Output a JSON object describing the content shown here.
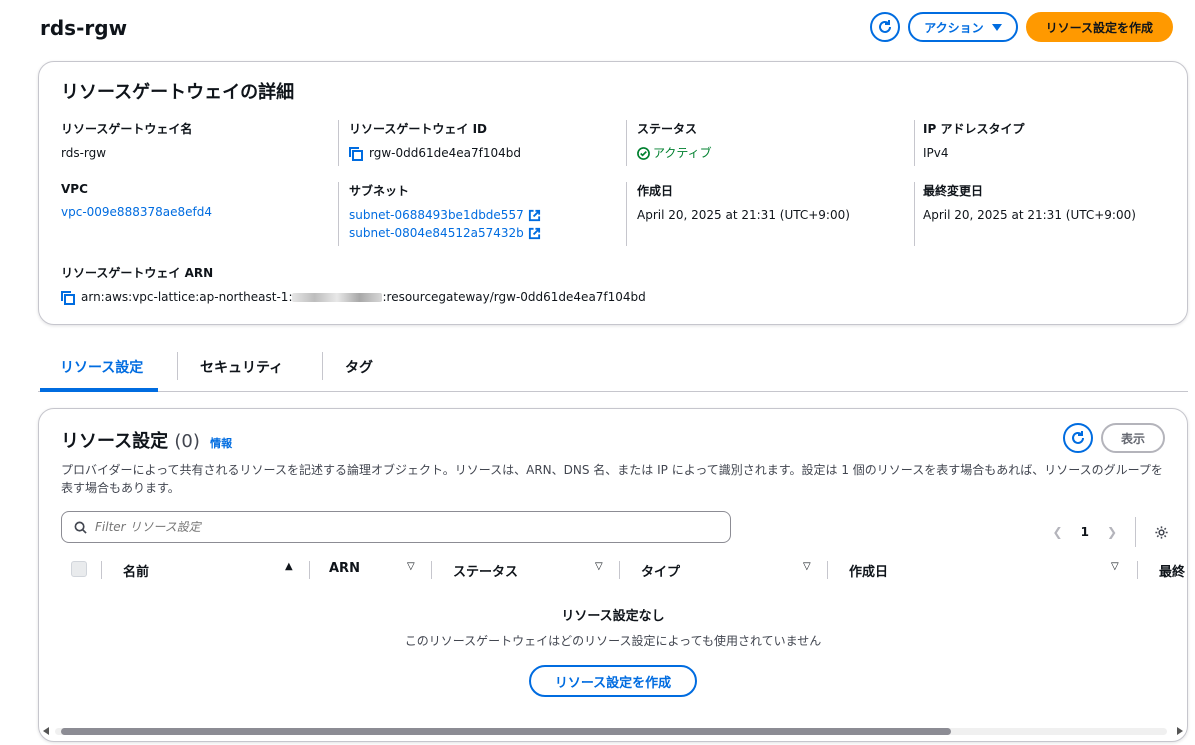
{
  "header": {
    "title": "rds-rgw",
    "refresh_icon": "refresh-icon",
    "actions_label": "アクション",
    "create_label": "リソース設定を作成"
  },
  "details": {
    "title": "リソースゲートウェイの詳細",
    "name_label": "リソースゲートウェイ名",
    "name_value": "rds-rgw",
    "id_label": "リソースゲートウェイ ID",
    "id_value": "rgw-0dd61de4ea7f104bd",
    "status_label": "ステータス",
    "status_value": "アクティブ",
    "ip_label": "IP アドレスタイプ",
    "ip_value": "IPv4",
    "vpc_label": "VPC",
    "vpc_value": "vpc-009e888378ae8efd4",
    "subnet_label": "サブネット",
    "subnets": [
      "subnet-0688493be1dbde557",
      "subnet-0804e84512a57432b"
    ],
    "created_label": "作成日",
    "created_value": "April 20, 2025 at 21:31 (UTC+9:00)",
    "modified_label": "最終変更日",
    "modified_value": "April 20, 2025 at 21:31 (UTC+9:00)",
    "arn_label": "リソースゲートウェイ ARN",
    "arn_prefix": "arn:aws:vpc-lattice:ap-northeast-1:",
    "arn_suffix": ":resourcegateway/rgw-0dd61de4ea7f104bd"
  },
  "tabs": [
    {
      "label": "リソース設定",
      "active": true
    },
    {
      "label": "セキュリティ",
      "active": false
    },
    {
      "label": "タグ",
      "active": false
    }
  ],
  "resource_table": {
    "title": "リソース設定",
    "count": "(0)",
    "info": "情報",
    "description": "プロバイダーによって共有されるリソースを記述する論理オブジェクト。リソースは、ARN、DNS 名、または IP によって識別されます。設定は 1 個のリソースを表す場合もあれば、リソースのグループを表す場合もあります。",
    "view_label": "表示",
    "filter_placeholder": "Filter リソース設定",
    "page": "1",
    "columns": [
      "名前",
      "ARN",
      "ステータス",
      "タイプ",
      "作成日",
      "最終"
    ],
    "empty_title": "リソース設定なし",
    "empty_desc": "このリソースゲートウェイはどのリソース設定によっても使用されていません",
    "empty_button": "リソース設定を作成"
  }
}
